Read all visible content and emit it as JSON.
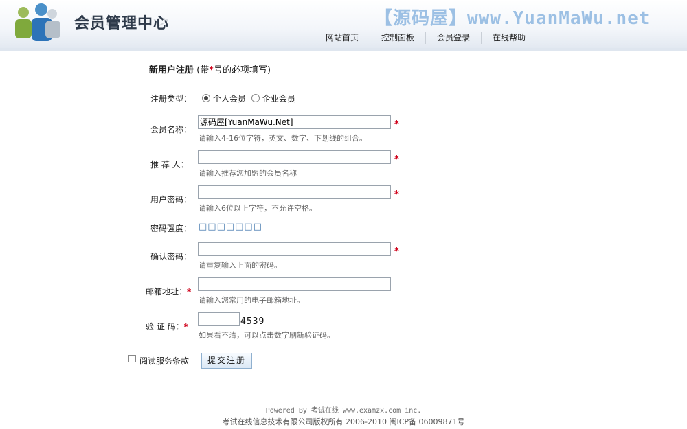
{
  "header": {
    "logo_text": "会员管理中心",
    "watermark": "【源码屋】www.YuanMaWu.net",
    "nav": [
      "网站首页",
      "控制面板",
      "会员登录",
      "在线帮助"
    ]
  },
  "form": {
    "title_bold": "新用户注册",
    "title_prefix": "(带",
    "title_star": "*",
    "title_suffix": "号的必项填写)",
    "type_label": "注册类型：",
    "type_options": [
      "个人会员",
      "企业会员"
    ],
    "type_selected": "个人会员",
    "username_label": "会员名称：",
    "username_value": "源码屋[YuanMaWu.Net]",
    "username_hint": "请输入4-16位字符，英文、数字、下划线的组合。",
    "referrer_label": "推 荐 人：",
    "referrer_value": "",
    "referrer_hint": "请输入推荐您加盟的会员名称",
    "password_label": "用户密码：",
    "password_value": "",
    "password_hint": "请输入6位以上字符，不允许空格。",
    "strength_label": "密码强度：",
    "strength_value": "□□□□□□□",
    "confirm_label": "确认密码：",
    "confirm_value": "",
    "confirm_hint": "请重复输入上面的密码。",
    "email_label": "邮箱地址：",
    "email_value": "",
    "email_hint": "请输入您常用的电子邮箱地址。",
    "captcha_label": "验 证 码：",
    "captcha_value": "",
    "captcha_code": "4539",
    "captcha_hint": "如果看不清，可以点击数字刷新验证码。",
    "required_mark": "*",
    "agree_label": "阅读服务条款",
    "submit_label": "提交注册"
  },
  "footer": {
    "line1": "Powered By 考试在线 www.examzx.com inc.",
    "line2": "考试在线信息技术有限公司版权所有 2006-2010 闽ICP备 06009871号"
  },
  "colors": {
    "accent_blue": "#4a7db1",
    "required_red": "#d0021b",
    "watermark_blue": "#9cc0e4"
  }
}
